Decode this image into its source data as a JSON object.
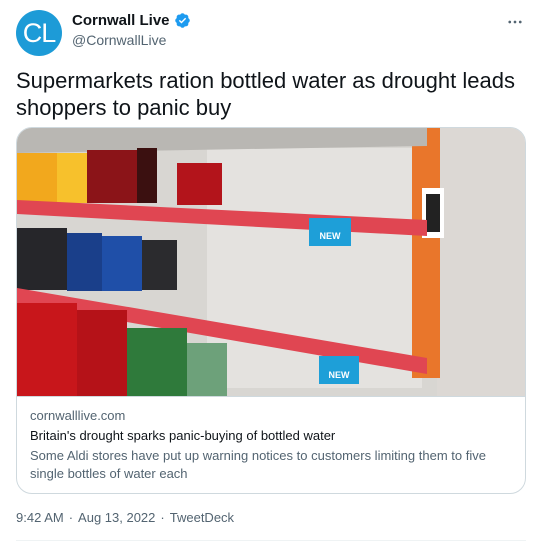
{
  "author": {
    "avatar_text": "CL",
    "display_name": "Cornwall Live",
    "handle": "@CornwallLive",
    "verified": true
  },
  "tweet": {
    "text": "Supermarkets ration bottled water as drought leads shoppers to panic buy"
  },
  "card": {
    "image_signs": [
      "NEW",
      "NEW"
    ],
    "domain": "cornwalllive.com",
    "title": "Britain's drought sparks panic-buying of bottled water",
    "description": "Some Aldi stores have put up warning notices to customers limiting them to five single bottles of water each"
  },
  "footer": {
    "time": "9:42 AM",
    "separator": "·",
    "date": "Aug 13, 2022",
    "source": "TweetDeck"
  },
  "colors": {
    "accent": "#1d9bf0",
    "avatar_bg": "#1d9bd7",
    "text_primary": "#0f1419",
    "text_secondary": "#536471",
    "border": "#cfd9de"
  },
  "icons": {
    "verified": "verified-badge-icon",
    "more": "more-horizontal-icon"
  }
}
